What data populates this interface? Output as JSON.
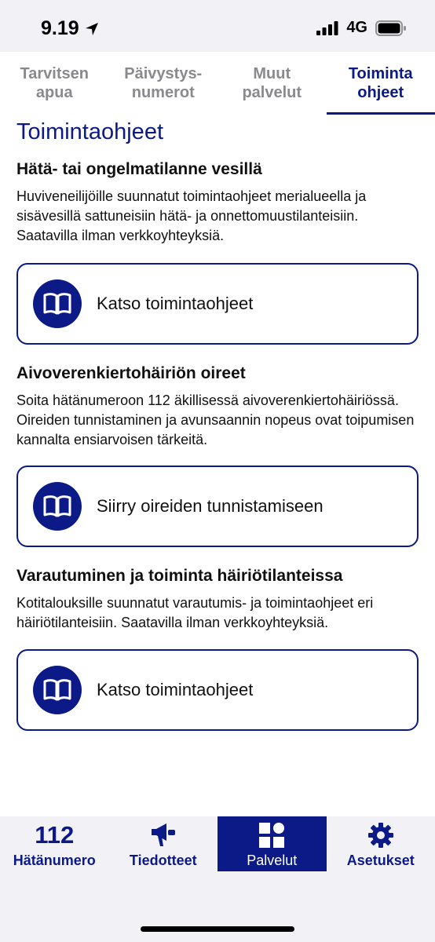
{
  "status_bar": {
    "time": "9.19",
    "network": "4G"
  },
  "tabs": [
    {
      "label": "Tarvitsen\napua",
      "active": false
    },
    {
      "label": "Päivystys-\nnumerot",
      "active": false
    },
    {
      "label": "Muut\npalvelut",
      "active": false
    },
    {
      "label": "Toiminta\nohjeet",
      "active": true
    }
  ],
  "page": {
    "title": "Toimintaohjeet",
    "sections": [
      {
        "title": "Hätä- tai ongelmatilanne vesillä",
        "text": "Huviveneilijöille suunnatut toimintaohjeet merialueella ja sisävesillä sattuneisiin hätä- ja onnettomuustilanteisiin. Saatavilla ilman verkkoyhteyksiä.",
        "button": "Katso toimintaohjeet"
      },
      {
        "title": "Aivoverenkiertohäiriön oireet",
        "text": "Soita hätänumeroon 112 äkillisessä aivoverenkiertohäiriössä. Oireiden tunnistaminen ja avunsaannin nopeus ovat toipumisen kannalta ensiarvoisen tärkeitä.",
        "button": "Siirry oireiden tunnistamiseen"
      },
      {
        "title": "Varautuminen ja toiminta häiriötilanteissa",
        "text": "Kotitalouksille suunnatut varautumis- ja toimintaohjeet eri häiriötilanteisiin. Saatavilla ilman verkkoyhteyksiä.",
        "button": "Katso toimintaohjeet"
      }
    ]
  },
  "bottom_nav": [
    {
      "icon_text": "112",
      "label": "Hätänumero",
      "active": false
    },
    {
      "icon": "megaphone-icon",
      "label": "Tiedotteet",
      "active": false
    },
    {
      "icon": "services-grid-icon",
      "label": "Palvelut",
      "active": true
    },
    {
      "icon": "gear-icon",
      "label": "Asetukset",
      "active": false
    }
  ],
  "colors": {
    "brand": "#0b1a86",
    "inactive_tab": "#8a8a8e",
    "background": "#f2f2f6"
  }
}
